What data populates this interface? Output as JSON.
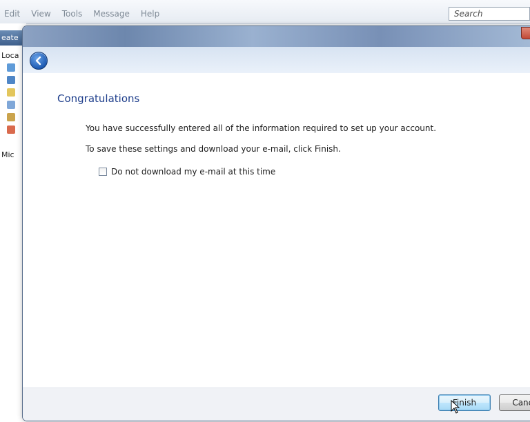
{
  "background_app": {
    "menu": [
      "Edit",
      "View",
      "Tools",
      "Message",
      "Help"
    ],
    "search_placeholder": "Search",
    "create_fragment": "eate",
    "local_fragment": "Loca",
    "micro_fragment": "Mic"
  },
  "wizard": {
    "heading": "Congratulations",
    "message_line1": "You have successfully entered all of the information required to set up your account.",
    "message_line2": "To save these settings and download your e-mail, click Finish.",
    "checkbox_label": "Do not download my e-mail at this time",
    "checkbox_checked": false,
    "buttons": {
      "finish": "Finish",
      "cancel": "Cance"
    }
  },
  "colors": {
    "heading": "#1f3f8c",
    "accent": "#3c7fb1"
  },
  "icons": [
    "back-arrow-icon",
    "mouse-pointer-icon",
    "folder-icon"
  ]
}
